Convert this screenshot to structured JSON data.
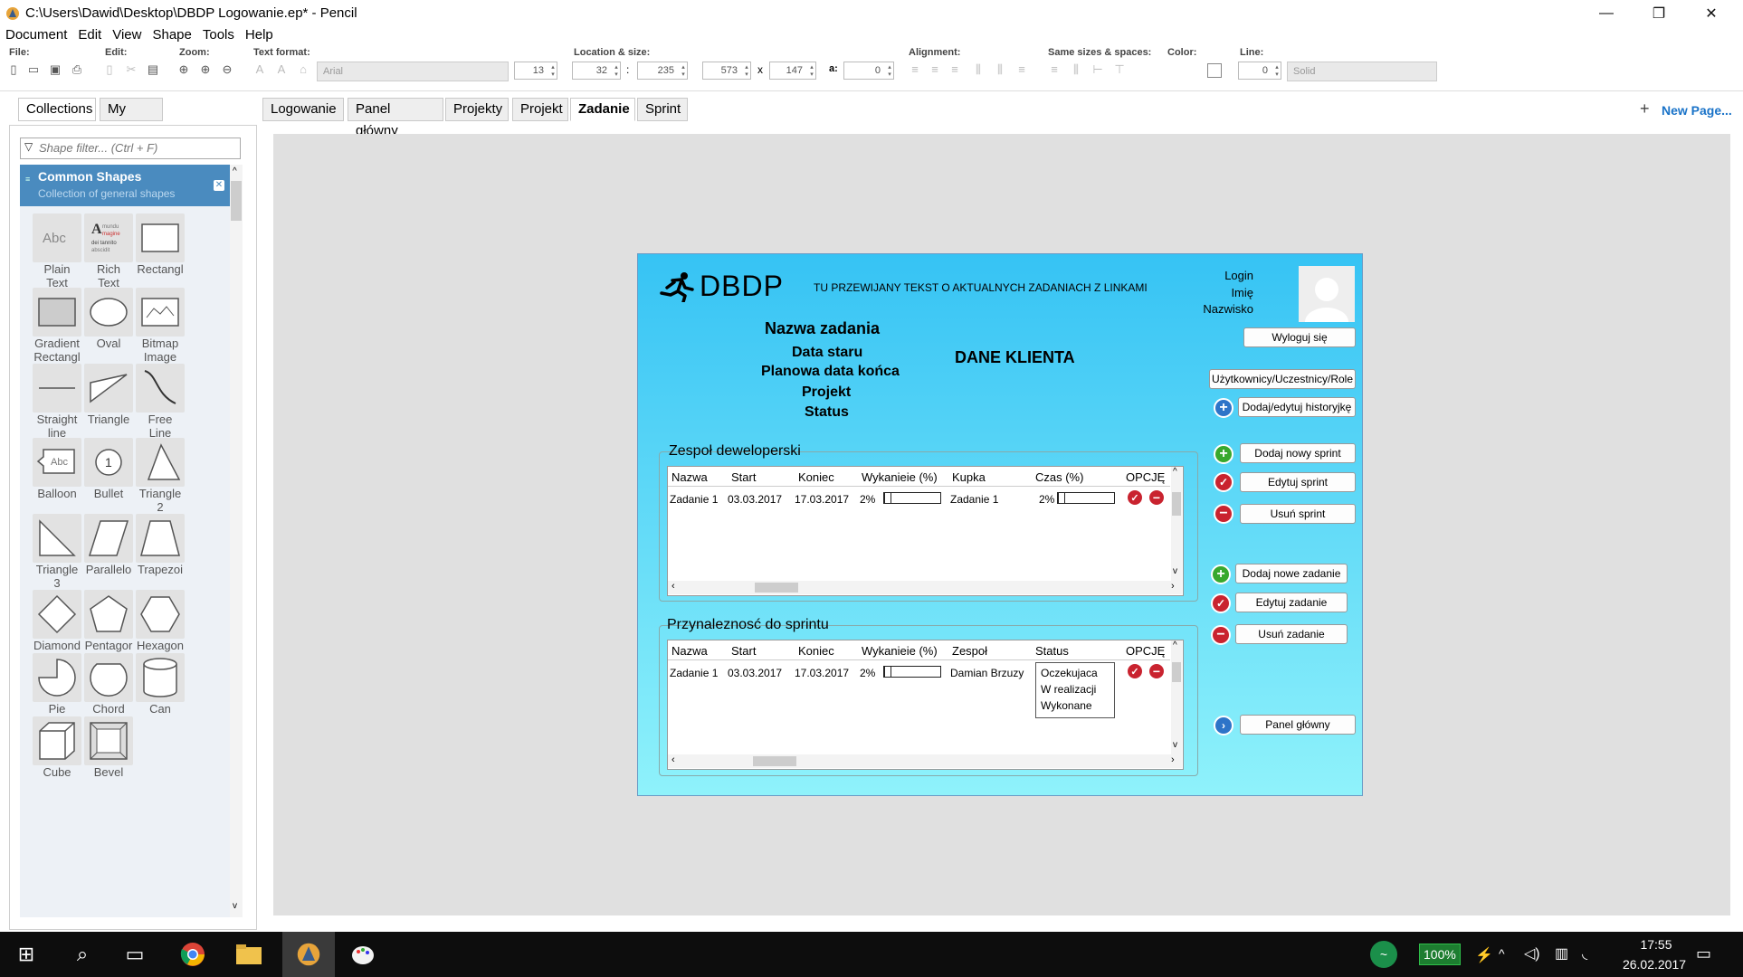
{
  "window": {
    "title": "C:\\Users\\Dawid\\Desktop\\DBDP Logowanie.ep* - Pencil",
    "minimize": "—",
    "maximize": "❐",
    "close": "✕"
  },
  "menu": [
    "Document",
    "Edit",
    "View",
    "Shape",
    "Tools",
    "Help"
  ],
  "toolbar": {
    "file_label": "File:",
    "edit_label": "Edit:",
    "zoom_label": "Zoom:",
    "text_format_label": "Text format:",
    "font_value": "Arial",
    "font_size": "13",
    "location_label": "Location & size:",
    "x": "32",
    "y": "235",
    "w": "573",
    "h": "147",
    "angle_label": "a:",
    "angle": "0",
    "sep_colon": ":",
    "sep_x": "x",
    "alignment_label": "Alignment:",
    "same_sizes_label": "Same sizes & spaces:",
    "color_label": "Color:",
    "line_label": "Line:",
    "line_width": "0",
    "line_style": "Solid"
  },
  "sidebar": {
    "tabs": [
      "Collections",
      "My Stuff"
    ],
    "filter_placeholder": "Shape filter... (Ctrl + F)",
    "collection_title": "Common Shapes",
    "collection_subtitle": "Collection of general shapes",
    "shapes": [
      {
        "name": "Plain Text",
        "l1": "Plain",
        "l2": "Text",
        "icon": "plain-text-icon"
      },
      {
        "name": "Rich Text",
        "l1": "Rich",
        "l2": "Text",
        "icon": "rich-text-icon"
      },
      {
        "name": "Rectangle",
        "l1": "Rectangl",
        "l2": "",
        "icon": "rectangle-icon"
      },
      {
        "name": "Gradient Rectangle",
        "l1": "Gradient",
        "l2": "Rectangl",
        "icon": "gradient-rectangle-icon"
      },
      {
        "name": "Oval",
        "l1": "Oval",
        "l2": "",
        "icon": "oval-icon"
      },
      {
        "name": "Bitmap Image",
        "l1": "Bitmap",
        "l2": "Image",
        "icon": "bitmap-image-icon"
      },
      {
        "name": "Straight line",
        "l1": "Straight",
        "l2": "line",
        "icon": "straight-line-icon"
      },
      {
        "name": "Triangle",
        "l1": "Triangle",
        "l2": "",
        "icon": "triangle-icon"
      },
      {
        "name": "Free Line",
        "l1": "Free",
        "l2": "Line",
        "icon": "free-line-icon"
      },
      {
        "name": "Balloon",
        "l1": "Balloon",
        "l2": "",
        "icon": "balloon-icon"
      },
      {
        "name": "Bullet",
        "l1": "Bullet",
        "l2": "",
        "icon": "bullet-icon"
      },
      {
        "name": "Triangle 2",
        "l1": "Triangle",
        "l2": "2",
        "icon": "triangle-2-icon"
      },
      {
        "name": "Triangle 3",
        "l1": "Triangle",
        "l2": "3",
        "icon": "triangle-3-icon"
      },
      {
        "name": "Parallelogram",
        "l1": "Parallelo",
        "l2": "",
        "icon": "parallelogram-icon"
      },
      {
        "name": "Trapezoid",
        "l1": "Trapezoi",
        "l2": "",
        "icon": "trapezoid-icon"
      },
      {
        "name": "Diamond",
        "l1": "Diamond",
        "l2": "",
        "icon": "diamond-icon"
      },
      {
        "name": "Pentagon",
        "l1": "Pentagor",
        "l2": "",
        "icon": "pentagon-icon"
      },
      {
        "name": "Hexagon",
        "l1": "Hexagon",
        "l2": "",
        "icon": "hexagon-icon"
      },
      {
        "name": "Pie",
        "l1": "Pie",
        "l2": "",
        "icon": "pie-icon"
      },
      {
        "name": "Chord",
        "l1": "Chord",
        "l2": "",
        "icon": "chord-icon"
      },
      {
        "name": "Can",
        "l1": "Can",
        "l2": "",
        "icon": "can-icon"
      },
      {
        "name": "Cube",
        "l1": "Cube",
        "l2": "",
        "icon": "cube-icon"
      },
      {
        "name": "Bevel",
        "l1": "Bevel",
        "l2": "",
        "icon": "bevel-icon"
      }
    ],
    "rich_text_sample": [
      "mundu",
      "magine",
      "dei tannito",
      "abscidit"
    ],
    "balloon_sample": "Abc",
    "bullet_sample": "1",
    "plain_sample": "Abc"
  },
  "page_tabs": [
    "Logowanie",
    "Panel główny",
    "Projekty",
    "Projekt",
    "Zadanie",
    "Sprint"
  ],
  "active_tab": "Zadanie",
  "new_page": "New Page...",
  "mockup": {
    "logo": "DBDP",
    "ticker": "TU PRZEWIJANY TEKST O AKTUALNYCH ZADANIACH Z LINKAMI",
    "user": [
      "Login",
      "Imię",
      "Nazwisko"
    ],
    "logout": "Wyloguj się",
    "task_info": [
      "Nazwa zadania",
      "Data staru",
      "Planowa data końca",
      "Projekt",
      "Status"
    ],
    "client": "DANE KLIENTA",
    "right_buttons": {
      "users": "Użytkownicy/Uczestnicy/Role",
      "history": "Dodaj/edytuj historyjkę",
      "add_sprint": "Dodaj nowy sprint",
      "edit_sprint": "Edytuj sprint",
      "del_sprint": "Usuń sprint",
      "add_task": "Dodaj nowe zadanie",
      "edit_task": "Edytuj zadanie",
      "del_task": "Usuń zadanie",
      "main_panel": "Panel główny"
    },
    "team_group": {
      "title": "Zespoł deweloperski",
      "headers": [
        "Nazwa",
        "Start",
        "Koniec",
        "Wykanieie (%)",
        "Kupka",
        "Czas (%)",
        "OPCJĘ"
      ],
      "row": {
        "name": "Zadanie 1",
        "start": "03.03.2017",
        "end": "17.03.2017",
        "pct": "2%",
        "kupka": "Zadanie 1",
        "czas": "2%"
      },
      "progress": 0.02,
      "time_progress": 0.02
    },
    "sprint_group": {
      "title": "Przynaleznosć do sprintu",
      "headers": [
        "Nazwa",
        "Start",
        "Koniec",
        "Wykanieie (%)",
        "Zespoł",
        "Status",
        "OPCJĘ"
      ],
      "row": {
        "name": "Zadanie 1",
        "start": "03.03.2017",
        "end": "17.03.2017",
        "pct": "2%",
        "team": "Damian Brzuzy"
      },
      "progress": 0.02,
      "status_options": [
        "Oczekujaca",
        "W realizacji",
        "Wykonane"
      ]
    }
  },
  "taskbar": {
    "battery": "100%",
    "time": "17:55",
    "date": "26.02.2017"
  },
  "colors": {
    "collection_header": "#4a8bbf",
    "mock_top": "#36c3f4",
    "mock_bottom": "#8ff2fb",
    "green": "#38a82d",
    "red": "#c9232f",
    "blue": "#2d74c8",
    "link_blue": "#1a73c8"
  }
}
